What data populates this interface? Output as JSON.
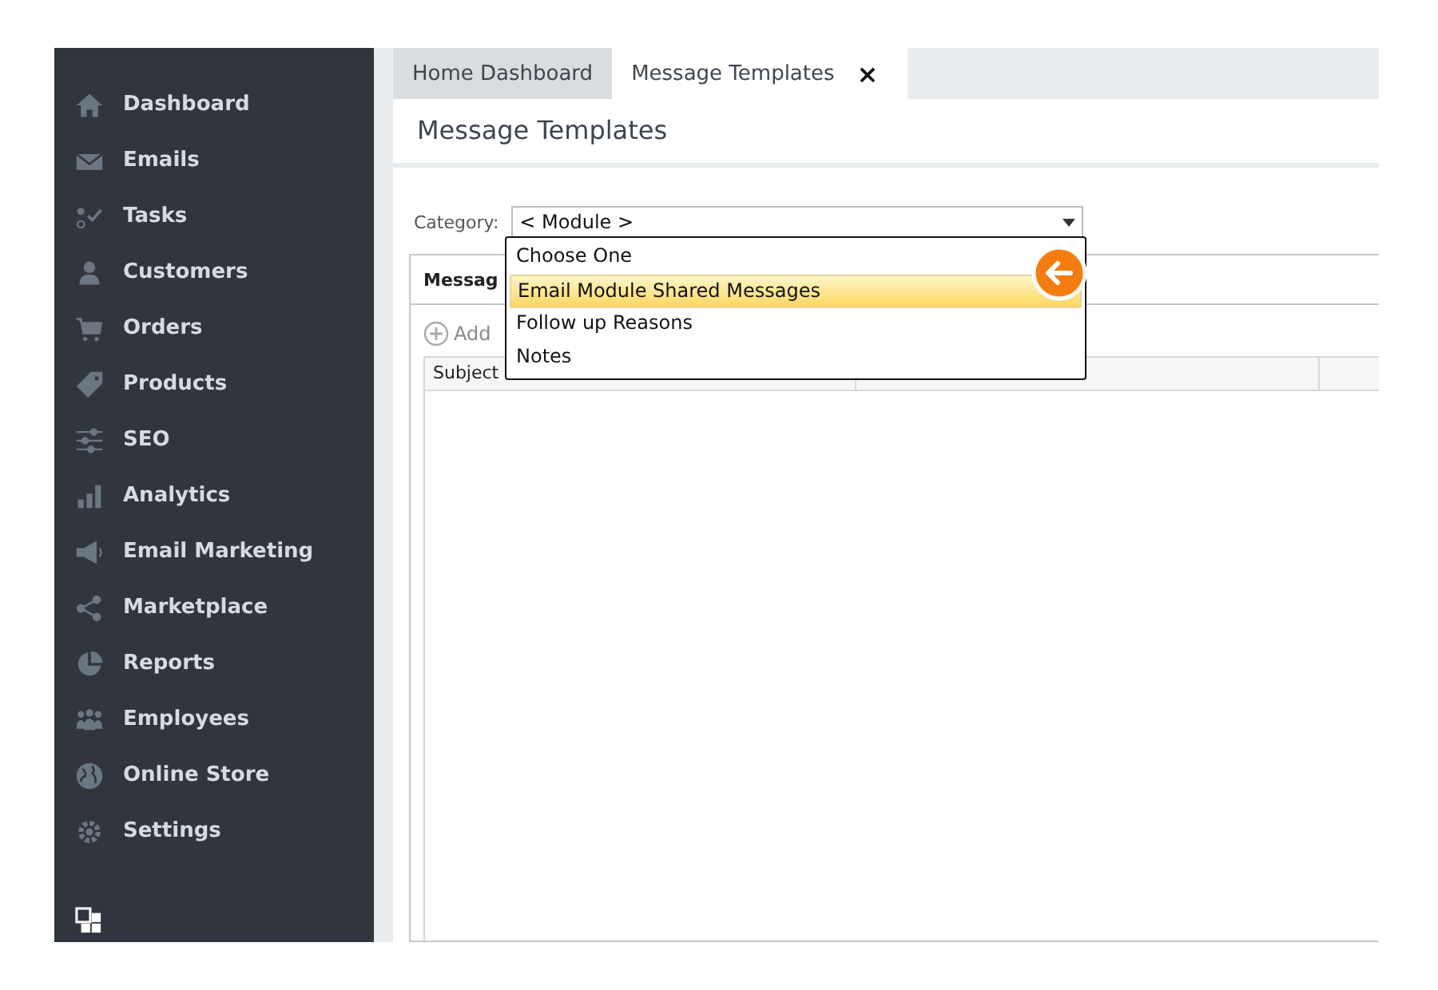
{
  "sidebar": {
    "items": [
      {
        "label": "Dashboard"
      },
      {
        "label": "Emails"
      },
      {
        "label": "Tasks"
      },
      {
        "label": "Customers"
      },
      {
        "label": "Orders"
      },
      {
        "label": "Products"
      },
      {
        "label": "SEO"
      },
      {
        "label": "Analytics"
      },
      {
        "label": "Email Marketing"
      },
      {
        "label": "Marketplace"
      },
      {
        "label": "Reports"
      },
      {
        "label": "Employees"
      },
      {
        "label": "Online Store"
      },
      {
        "label": "Settings"
      }
    ]
  },
  "tabs": [
    {
      "label": "Home Dashboard",
      "selected": false
    },
    {
      "label": "Message Templates",
      "selected": true,
      "close": "×"
    }
  ],
  "page_title": "Message Templates",
  "category": {
    "label": "Category:",
    "value": "< Module >"
  },
  "dropdown": {
    "options": [
      {
        "label": "Choose One",
        "selected": false
      },
      {
        "label": "Email Module Shared Messages",
        "selected": true
      },
      {
        "label": "Follow up Reasons",
        "selected": false
      },
      {
        "label": "Notes",
        "selected": false
      }
    ]
  },
  "panel": {
    "title": "Messag",
    "add_label": "Add"
  },
  "table": {
    "columns": [
      "Subject"
    ]
  }
}
